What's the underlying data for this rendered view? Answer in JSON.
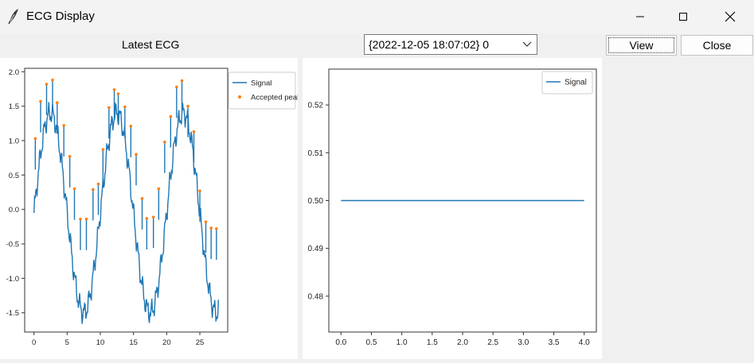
{
  "window": {
    "title": "ECG Display"
  },
  "toolbar": {
    "latest_label": "Latest ECG",
    "record_selected": "{2022-12-05 18:07:02} 0",
    "view_label": "View",
    "close_label": "Close"
  },
  "chart_data": [
    {
      "type": "line",
      "title": "",
      "xlabel": "",
      "ylabel": "",
      "xlim": [
        -1.4,
        29.2
      ],
      "ylim": [
        -1.78,
        2.05
      ],
      "x_ticks": [
        0,
        5,
        10,
        15,
        20,
        25
      ],
      "y_ticks": [
        2.0,
        1.5,
        1.0,
        0.5,
        0.0,
        -0.5,
        -1.0,
        -1.5
      ],
      "x_tick_labels": [
        "0",
        "5",
        "10",
        "15",
        "20",
        "25"
      ],
      "y_tick_labels": [
        "2.0",
        "1.5",
        "1.0",
        "0.5",
        "0.0",
        "-0.5",
        "-1.0",
        "-1.5"
      ],
      "grid": false,
      "legend_position": "outside-right",
      "series": [
        {
          "name": "Signal",
          "kind": "line",
          "color": "#1f77b4",
          "x_start": 0,
          "x_end": 27.8,
          "n": 300,
          "period": 10,
          "amplitude": 1.45,
          "offset": -0.05
        },
        {
          "name": "Accepted peaks",
          "kind": "scatter",
          "color": "#ff7f0e",
          "x": [
            0.2,
            1.0,
            1.9,
            2.8,
            3.5,
            4.5,
            5.4,
            6.1,
            7.0,
            7.9,
            8.9,
            9.7,
            10.4,
            11.3,
            12.1,
            12.7,
            13.7,
            14.6,
            15.4,
            16.3,
            17.0,
            18.0,
            18.8,
            19.7,
            20.6,
            21.5,
            22.3,
            23.2,
            24.1,
            25.0,
            25.9,
            26.7,
            27.5
          ],
          "y": [
            1.03,
            1.57,
            1.82,
            1.88,
            1.55,
            1.22,
            0.77,
            0.3,
            -0.14,
            -0.14,
            0.29,
            0.37,
            0.87,
            1.48,
            1.74,
            1.68,
            1.49,
            1.21,
            0.8,
            0.16,
            -0.13,
            -0.11,
            0.3,
            0.98,
            1.35,
            1.78,
            1.87,
            1.5,
            1.13,
            0.27,
            -0.18,
            -0.27,
            -0.28
          ]
        }
      ]
    },
    {
      "type": "line",
      "title": "",
      "xlabel": "",
      "ylabel": "",
      "xlim": [
        -0.2,
        4.2
      ],
      "ylim": [
        0.4725,
        0.5275
      ],
      "x_ticks": [
        0.0,
        0.5,
        1.0,
        1.5,
        2.0,
        2.5,
        3.0,
        3.5,
        4.0
      ],
      "y_ticks": [
        0.52,
        0.51,
        0.5,
        0.49,
        0.48
      ],
      "x_tick_labels": [
        "0.0",
        "0.5",
        "1.0",
        "1.5",
        "2.0",
        "2.5",
        "3.0",
        "3.5",
        "4.0"
      ],
      "y_tick_labels": [
        "0.52",
        "0.51",
        "0.50",
        "0.49",
        "0.48"
      ],
      "grid": false,
      "legend_position": "top-right",
      "series": [
        {
          "name": "Signal",
          "kind": "line",
          "color": "#1f77b4",
          "x": [
            0,
            4
          ],
          "y": [
            0.5,
            0.5
          ]
        }
      ]
    }
  ]
}
